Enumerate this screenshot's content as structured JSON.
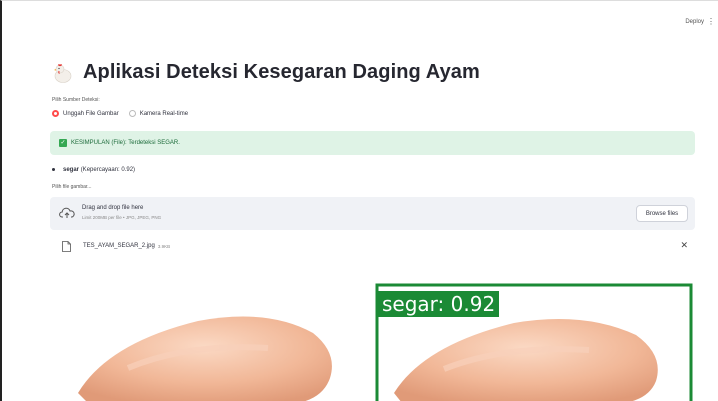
{
  "header": {
    "deploy_label": "Deploy",
    "menu_icon": "kebab-icon"
  },
  "app": {
    "title": "Aplikasi Deteksi Kesegaran Daging Ayam",
    "title_icon": "chicken-icon",
    "source_label": "Pilih Sumber Deteksi:",
    "source_options": [
      "Unggah File Gambar",
      "Kamera Real-time"
    ],
    "selected_source": "Unggah File Gambar"
  },
  "result": {
    "conclusion": "KESIMPULAN (File): Terdeteksi SEGAR.",
    "detection_class": "segar",
    "detection_conf": "(Kepercayaan: 0.92)"
  },
  "uploader": {
    "label": "Pilih file gambar...",
    "drop_title": "Drag and drop file here",
    "drop_sub": "Limit 200MB per file • JPG, JPEG, PNG",
    "browse_label": "Browse files",
    "file_name": "TES_AYAM_SEGAR_2.jpg",
    "file_size": "3.9KB"
  },
  "images": {
    "detection_label": "segar: 0.92",
    "box_color": "#1b8a35",
    "meat_color": "#f0b79a"
  }
}
